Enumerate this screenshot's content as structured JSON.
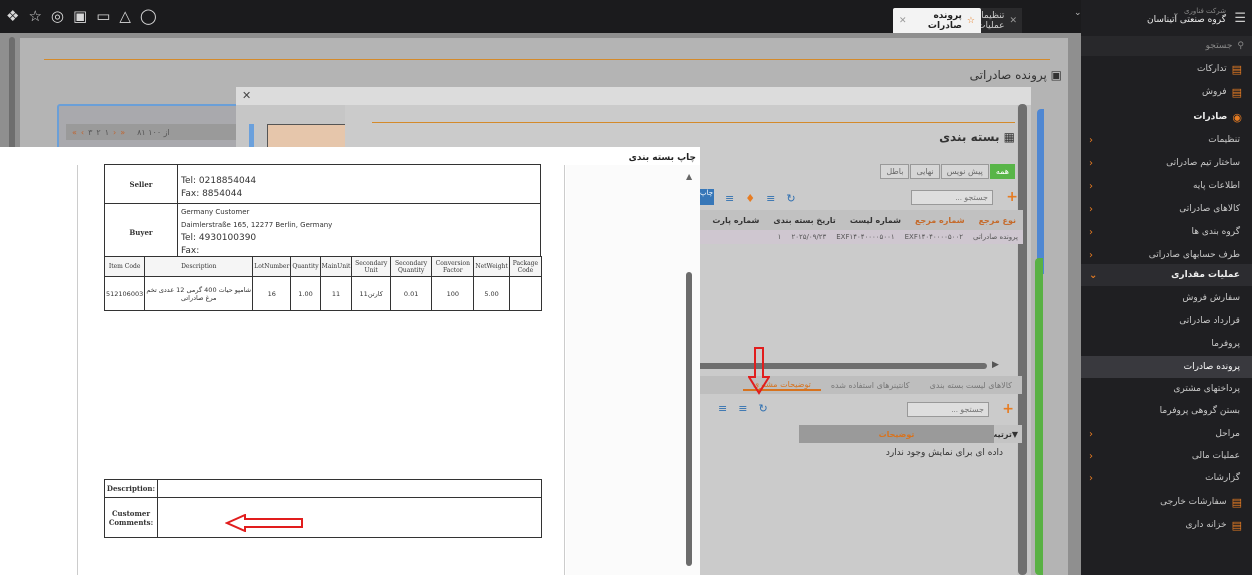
{
  "topbar": {
    "icons": [
      "logo-icon",
      "star-icon",
      "palette-icon",
      "image-icon",
      "folder-icon",
      "bell-icon",
      "user-icon"
    ],
    "tabs": [
      {
        "label": "پرونده صادرات",
        "active": true
      },
      {
        "label": "تنظیمات عملیات",
        "active": false
      }
    ]
  },
  "sidebar": {
    "brand_small": "شرکت فناوری",
    "brand_name": "گروه صنعتی آتیناسان",
    "search_placeholder": "جستجو",
    "items": [
      {
        "label": "تدارکات",
        "type": "top"
      },
      {
        "label": "فروش",
        "type": "top"
      },
      {
        "label": "صادرات",
        "type": "top-open"
      },
      {
        "label": "تنظیمات",
        "type": "sub"
      },
      {
        "label": "ساختار تیم صادراتی",
        "type": "sub"
      },
      {
        "label": "اطلاعات پایه",
        "type": "sub"
      },
      {
        "label": "کالاهای صادراتی",
        "type": "sub"
      },
      {
        "label": "گروه بندی ها",
        "type": "sub"
      },
      {
        "label": "طرف حسابهای صادراتی",
        "type": "sub"
      },
      {
        "label": "عملیات مقداری",
        "type": "sub-open"
      },
      {
        "label": "سفارش فروش",
        "type": "subsub"
      },
      {
        "label": "قرارداد صادراتی",
        "type": "subsub"
      },
      {
        "label": "پروفرما",
        "type": "subsub"
      },
      {
        "label": "پرونده صادرات",
        "type": "active"
      },
      {
        "label": "پرداختهای مشتری",
        "type": "subsub"
      },
      {
        "label": "بستن گروهی پروفرما",
        "type": "subsub"
      },
      {
        "label": "مراحل",
        "type": "sub"
      },
      {
        "label": "عملیات مالی",
        "type": "sub"
      },
      {
        "label": "گزارشات",
        "type": "sub"
      },
      {
        "label": "سفارشات خارجی",
        "type": "top"
      },
      {
        "label": "خزانه داری",
        "type": "top"
      }
    ]
  },
  "page": {
    "title": "پرونده صادراتی",
    "pager": "۸۱ از ۱۰۰"
  },
  "packing_modal": {
    "title": "بسته بندی",
    "peach_number": "۱",
    "filters": [
      "همه",
      "پیش نویس",
      "نهایی",
      "باطل"
    ],
    "search_placeholder": "جستجو ...",
    "print_button": "چاپ",
    "grid_columns": [
      "نوع مرجع",
      "شماره مرجع",
      "شماره لیست",
      "تاریخ بسته بندی",
      "شماره پارت"
    ],
    "grid_row": [
      "پرونده صادراتی",
      "EXF۱۴۰۴۰۰۰۰۵۰۰۲",
      "EXF۱۴۰۴۰۰۰۰۵۰۰۱",
      "۲۰۲۵/۰۹/۲۳",
      "۱"
    ],
    "detail_tabs": [
      "کالاهای لیست بسته بندی",
      "کانتینرهای استفاده شده",
      "توضیحات مشتری"
    ],
    "detail_search_placeholder": "جستجو ...",
    "detail_columns": [
      "ترتیب",
      "توضیحات"
    ],
    "empty_text": "داده ای برای نمایش وجود ندارد"
  },
  "print_modal": {
    "title": "چاپ بسته بندی",
    "seller": {
      "label": "Seller",
      "tel": "Tel:  0218854044",
      "fax": "Fax:  8854044"
    },
    "buyer": {
      "label": "Buyer",
      "name": "Germany Customer",
      "address": "Daimlerstraße 165, 12277 Berlin, Germany",
      "tel": "Tel:  4930100390",
      "fax": "Fax:"
    },
    "item_columns": [
      "Item Code",
      "Description",
      "LotNumber",
      "Quantity",
      "MainUnit",
      "Secondary Unit",
      "Secondary Quantity",
      "Conversion Factor",
      "NetWeight",
      "Package Code"
    ],
    "item_row": [
      "512106003",
      "شامپو حیات 400 گرمی 12 عددی تخم مرغ صادراتی",
      "16",
      "1.00",
      "11",
      "کارتن11",
      "0.01",
      "100",
      "5.00",
      ""
    ],
    "description_label": "Description:",
    "comments_label": "Customer Comments:"
  },
  "colors": {
    "accent": "#e77c22",
    "sidebar_bg": "#1f1f22",
    "arrow_red": "#e11d1d",
    "filter_active": "#58b548"
  }
}
